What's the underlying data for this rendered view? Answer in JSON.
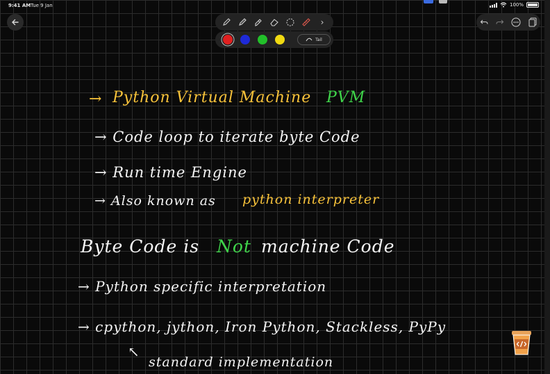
{
  "status": {
    "time": "9:41 AM",
    "date": "Tue 9 Jan",
    "battery": "100%"
  },
  "toolbar": {
    "tools": [
      "pencil-icon",
      "pen-icon",
      "highlighter-icon",
      "eraser-icon",
      "lasso-icon",
      "ruler-icon"
    ],
    "more": "›",
    "colors": [
      "#e02020",
      "#1e2ad8",
      "#22c02a",
      "#f1da12"
    ],
    "tail_label": "Tail"
  },
  "notes": {
    "l1": {
      "arrow": "→",
      "a": "Python Virtual Machine",
      "b": "PVM"
    },
    "l2": {
      "text": "→ Code loop to iterate byte Code"
    },
    "l3": {
      "text": "→ Run time Engine"
    },
    "l4": {
      "a": "→ Also known as",
      "b": "python interpreter"
    },
    "l5": {
      "a": "Byte Code is",
      "b": "Not",
      "c": "machine Code"
    },
    "l6": {
      "text": "→ Python specific interpretation"
    },
    "l7": {
      "text": "→ cpython, jython, Iron Python, Stackless, PyPy"
    },
    "l8": {
      "arrow": "↖",
      "text": "standard implementation"
    }
  }
}
